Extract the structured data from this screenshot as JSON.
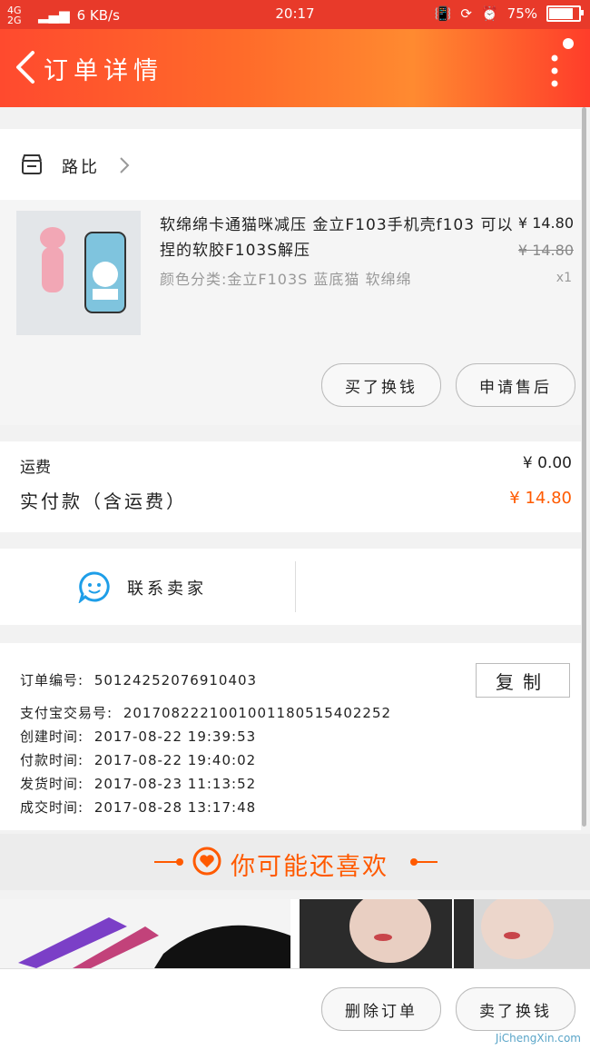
{
  "statusbar": {
    "network": "4G 2G",
    "speed": "6 KB/s",
    "time": "20:17",
    "battery": "75%",
    "battery_level": 0.75
  },
  "header": {
    "title": "订单详情"
  },
  "shop": {
    "name": "路比"
  },
  "product": {
    "title": "软绵绵卡通猫咪减压 金立F103手机壳f103 可以捏的软胶F103S解压",
    "price": "¥ 14.80",
    "original_price": "¥ 14.80",
    "spec": "颜色分类:金立F103S 蓝底猫 软绵绵",
    "quantity": "x1",
    "btn_buy_again": "买了换钱",
    "btn_after_sale": "申请售后"
  },
  "fees": {
    "shipping_label": "运费",
    "shipping_value": "¥ 0.00",
    "paid_label": "实付款（含运费）",
    "paid_value": "¥ 14.80"
  },
  "contact": {
    "label": "联系卖家"
  },
  "order_info": {
    "order_no_label": "订单编号:",
    "order_no": "50124252076910403",
    "copy_label": "复制",
    "alipay_label": "支付宝交易号:",
    "alipay_no": "2017082221001001180515402252",
    "created_label": "创建时间:",
    "created": "2017-08-22 19:39:53",
    "paid_label": "付款时间:",
    "paid": "2017-08-22 19:40:02",
    "shipped_label": "发货时间:",
    "shipped": "2017-08-23 11:13:52",
    "done_label": "成交时间:",
    "done": "2017-08-28 13:17:48"
  },
  "recommend": {
    "title": "你可能还喜欢"
  },
  "bottom": {
    "btn_delete": "删除订单",
    "btn_buy_again": "卖了换钱"
  },
  "watermark": "JiChengXin.com",
  "colors": {
    "accent": "#ff5a00",
    "header_start": "#ff4a2e",
    "header_end": "#ff8a30"
  }
}
